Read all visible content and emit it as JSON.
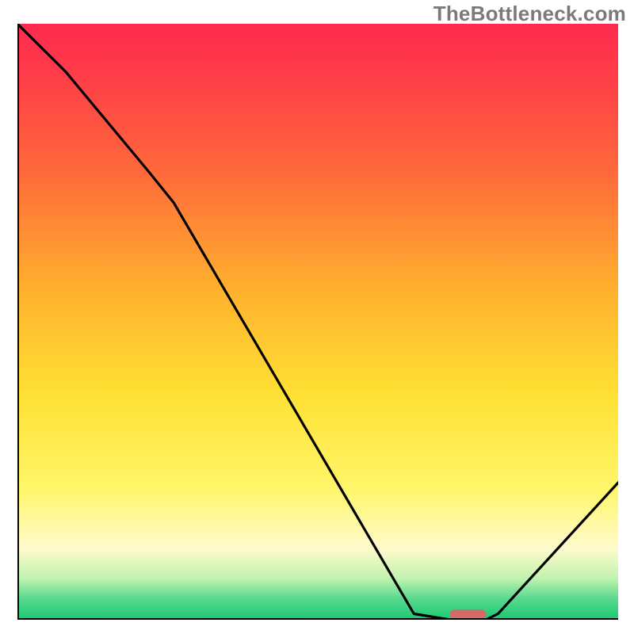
{
  "watermark": "TheBottleneck.com",
  "chart_data": {
    "type": "line",
    "title": "",
    "xlabel": "",
    "ylabel": "",
    "xlim": [
      0,
      100
    ],
    "ylim": [
      0,
      100
    ],
    "grid": false,
    "legend": false,
    "background": {
      "gradient_stops": [
        {
          "offset": 0.0,
          "color": "#ff2a4d"
        },
        {
          "offset": 0.08,
          "color": "#ff3b4a"
        },
        {
          "offset": 0.25,
          "color": "#ff6a3a"
        },
        {
          "offset": 0.45,
          "color": "#ffb22e"
        },
        {
          "offset": 0.62,
          "color": "#ffe033"
        },
        {
          "offset": 0.78,
          "color": "#fff66a"
        },
        {
          "offset": 0.88,
          "color": "#fffbcc"
        },
        {
          "offset": 0.93,
          "color": "#c2f3b0"
        },
        {
          "offset": 0.965,
          "color": "#58d98e"
        },
        {
          "offset": 1.0,
          "color": "#19c872"
        }
      ]
    },
    "series": [
      {
        "name": "bottleneck-curve",
        "stroke": "#000000",
        "x": [
          0,
          8,
          22,
          26,
          66,
          72,
          78,
          80,
          100
        ],
        "y": [
          100,
          92,
          75,
          70,
          1,
          0,
          0,
          1,
          23
        ]
      }
    ],
    "marker": {
      "name": "optimal-point",
      "x_center": 75,
      "width": 6,
      "color": "#d66a6a",
      "y": 0
    }
  },
  "colors": {
    "axis": "#000000"
  }
}
